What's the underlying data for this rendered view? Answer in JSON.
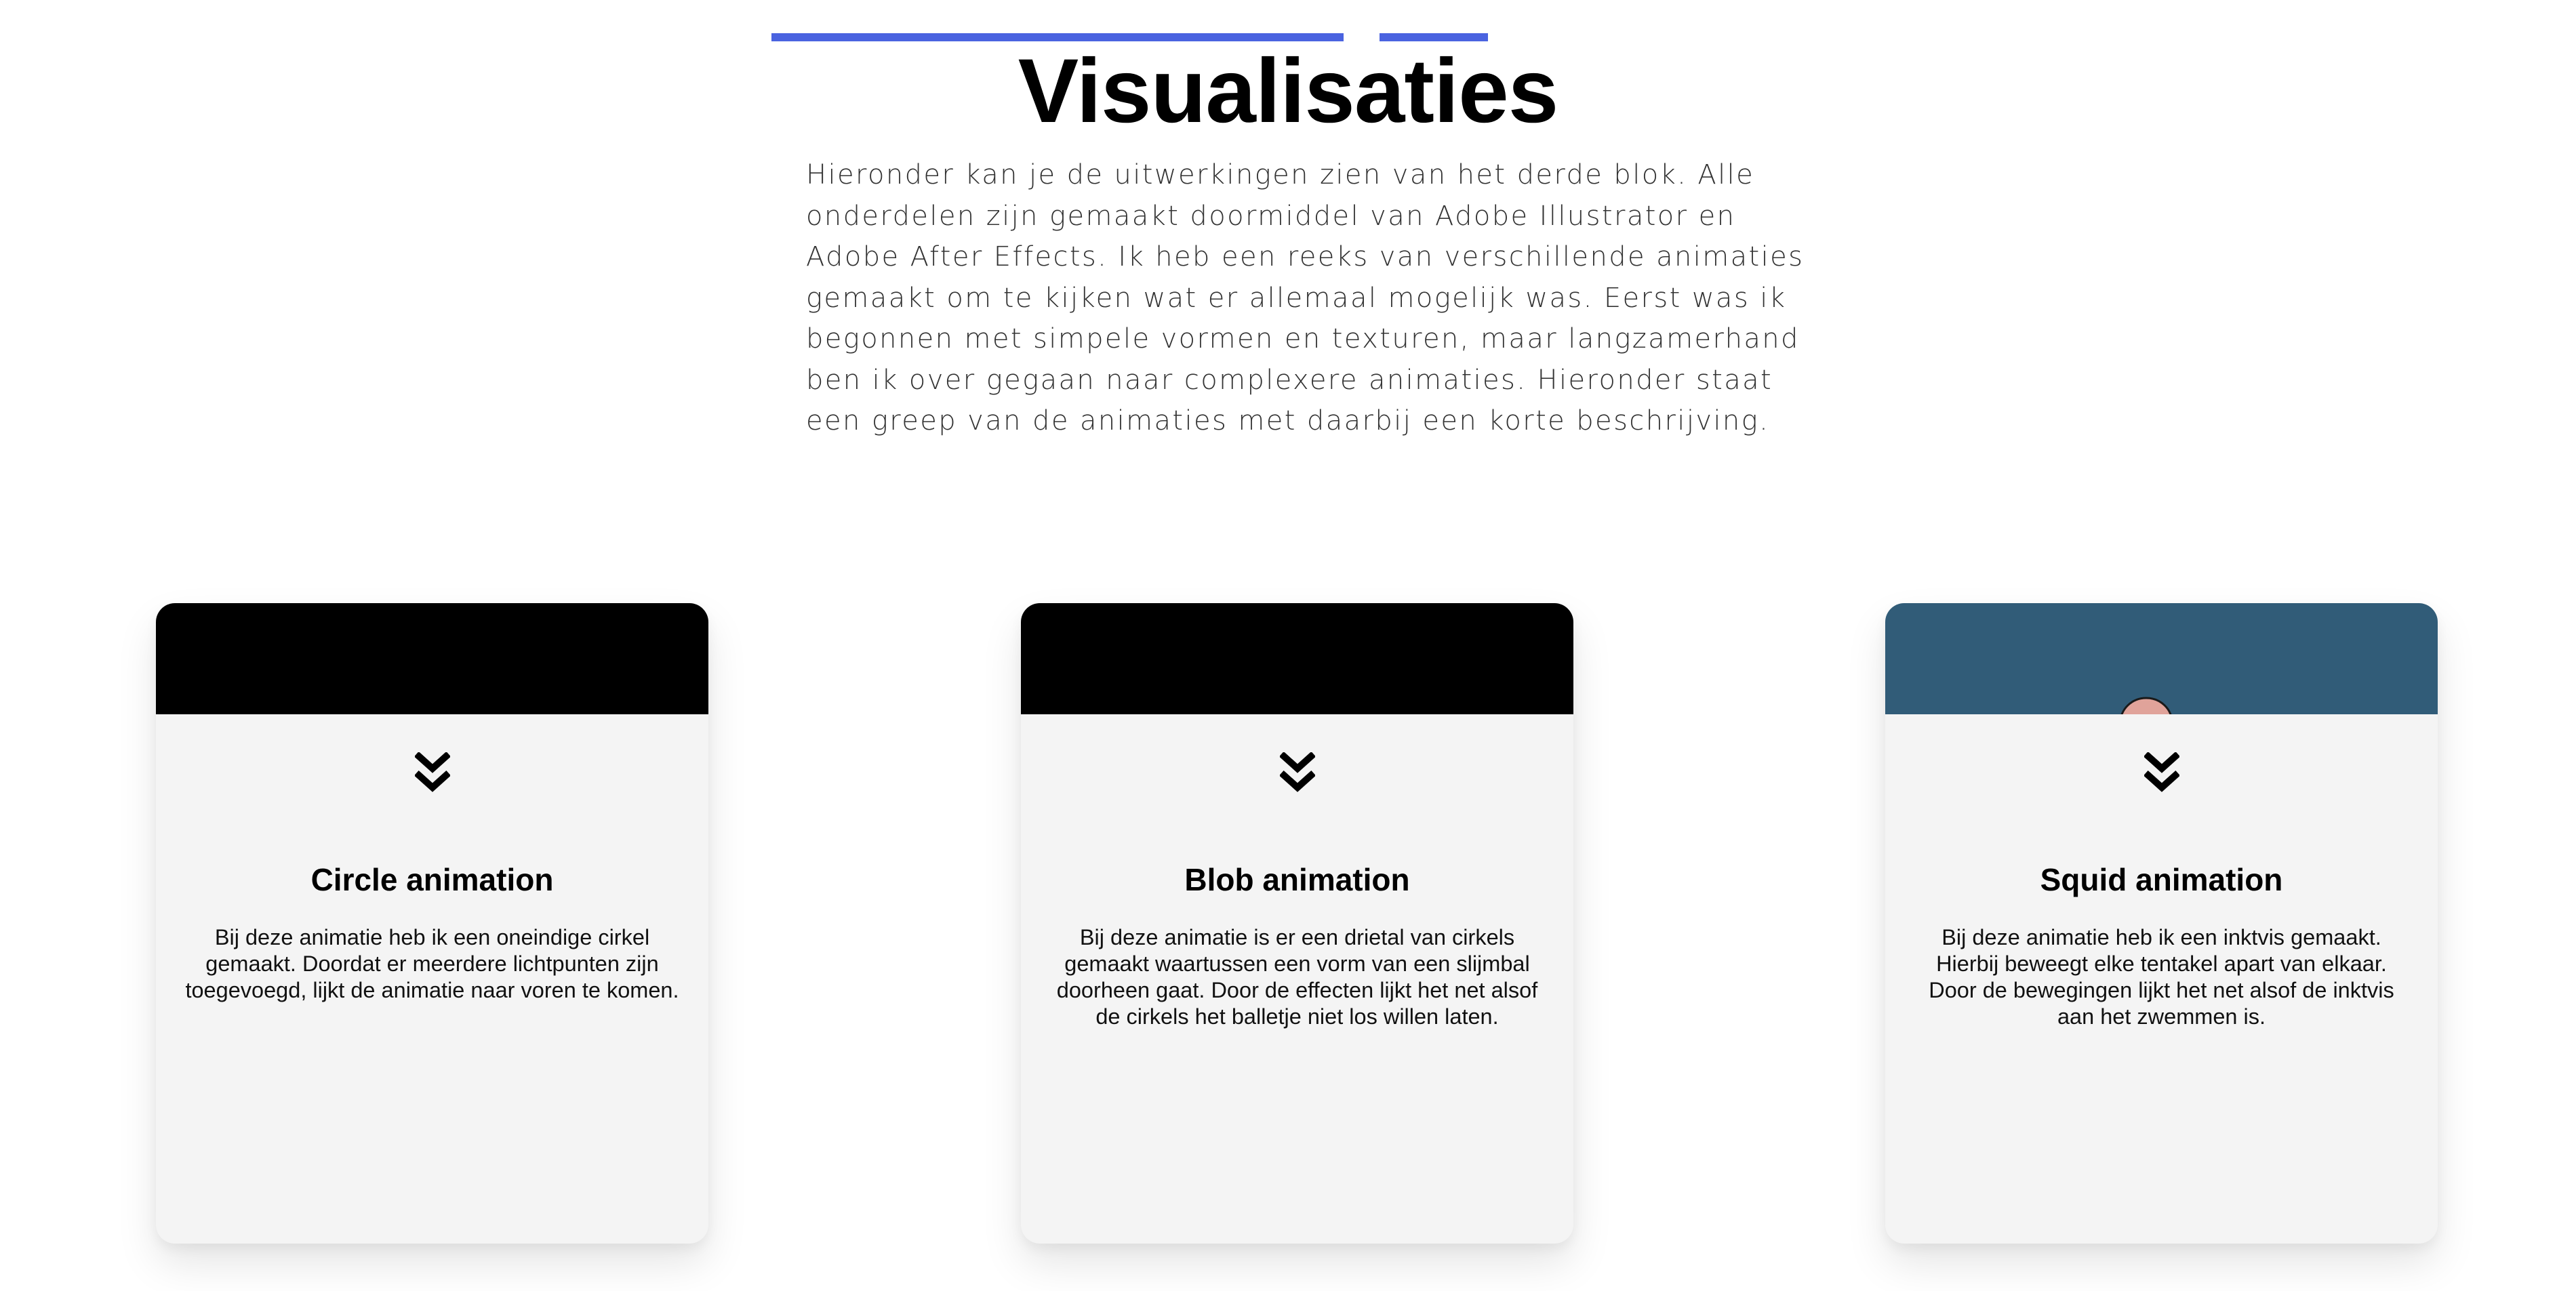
{
  "section": {
    "title": "Visualisaties",
    "intro": "Hieronder kan je de uitwerkingen zien van het derde blok. Alle onderdelen zijn gemaakt doormiddel van Adobe Illustrator en Adobe After Effects. Ik heb een reeks van verschillende animaties gemaakt om te kijken wat er allemaal mogelijk was. Eerst was ik begonnen met simpele vormen en texturen, maar langzamerhand ben ik over gegaan naar complexere animaties. Hieronder staat een greep van de animaties met daarbij een korte beschrijving."
  },
  "cards": [
    {
      "title": "Circle animation",
      "description": "Bij deze animatie heb ik een oneindige cirkel gemaakt. Doordat er meerdere lichtpunten zijn toegevoegd, lijkt de animatie naar voren te komen.",
      "media_color": "#000000",
      "expand_icon": "double-chevron-down-icon"
    },
    {
      "title": "Blob animation",
      "description": "Bij deze animatie is er een drietal van cirkels gemaakt waartussen een vorm van een slijmbal doorheen gaat. Door de effecten lijkt het net alsof de cirkels het balletje niet los willen laten.",
      "media_color": "#000000",
      "expand_icon": "double-chevron-down-icon"
    },
    {
      "title": "Squid animation",
      "description": "Bij deze animatie heb ik een inktvis gemaakt. Hierbij beweegt elke tentakel apart van elkaar. Door de bewegingen lijkt het net alsof de inktvis aan het zwemmen is.",
      "media_color": "#315c78",
      "accent_color": "#e0a39a",
      "expand_icon": "double-chevron-down-icon"
    }
  ],
  "colors": {
    "accent": "#4a63e0",
    "card_background": "#f4f4f4",
    "text": "#000000"
  }
}
